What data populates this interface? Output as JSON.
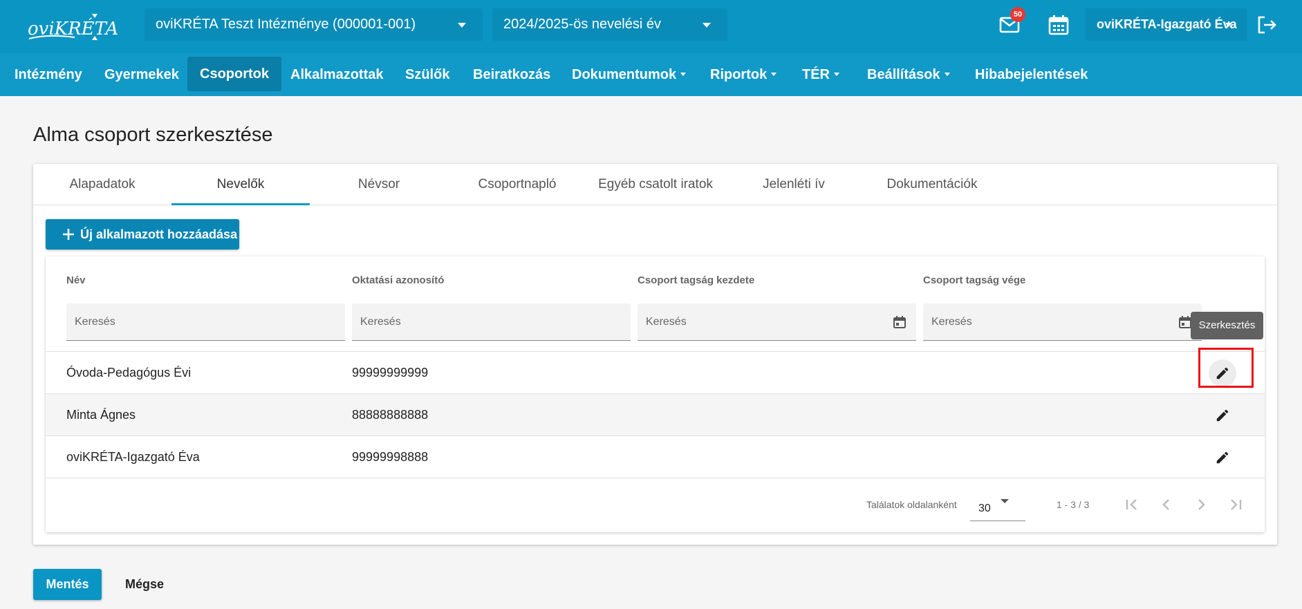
{
  "header": {
    "logo_text": "oviKRÉTA",
    "institution_select": "oviKRÉTA Teszt Intézménye (000001-001)",
    "year_select": "2024/2025-ös nevelési év",
    "mail_badge": "50",
    "user_name": "oviKRÉTA-Igazgató Éva"
  },
  "nav": {
    "items": [
      {
        "label": "Intézmény"
      },
      {
        "label": "Gyermekek"
      },
      {
        "label": "Csoportok"
      },
      {
        "label": "Alkalmazottak"
      },
      {
        "label": "Szülők"
      },
      {
        "label": "Beiratkozás"
      },
      {
        "label": "Dokumentumok"
      },
      {
        "label": "Riportok"
      },
      {
        "label": "TÉR"
      },
      {
        "label": "Beállítások"
      },
      {
        "label": "Hibabejelentések"
      }
    ]
  },
  "page": {
    "title": "Alma csoport szerkesztése"
  },
  "tabs": [
    {
      "label": "Alapadatok"
    },
    {
      "label": "Nevelők"
    },
    {
      "label": "Névsor"
    },
    {
      "label": "Csoportnapló"
    },
    {
      "label": "Egyéb csatolt iratok"
    },
    {
      "label": "Jelenléti ív"
    },
    {
      "label": "Dokumentációk"
    }
  ],
  "add_button": "Új alkalmazott hozzáadása",
  "table": {
    "columns": [
      "Név",
      "Oktatási azonosító",
      "Csoport tagság kezdete",
      "Csoport tagság vége"
    ],
    "search_placeholder": "Keresés",
    "rows": [
      {
        "name": "Óvoda-Pedagógus Évi",
        "id": "99999999999"
      },
      {
        "name": "Minta Ágnes",
        "id": "88888888888"
      },
      {
        "name": "oviKRÉTA-Igazgató Éva",
        "id": "99999998888"
      }
    ],
    "tooltip": "Szerkesztés",
    "per_page_label": "Találatok oldalanként",
    "per_page_value": "30",
    "range": "1 - 3 / 3"
  },
  "actions": {
    "save": "Mentés",
    "cancel": "Mégse"
  },
  "colors": {
    "header": "#0b95c3",
    "nav": "#1199c8",
    "accent": "#0a86b5",
    "highlight": "#ee1111"
  }
}
